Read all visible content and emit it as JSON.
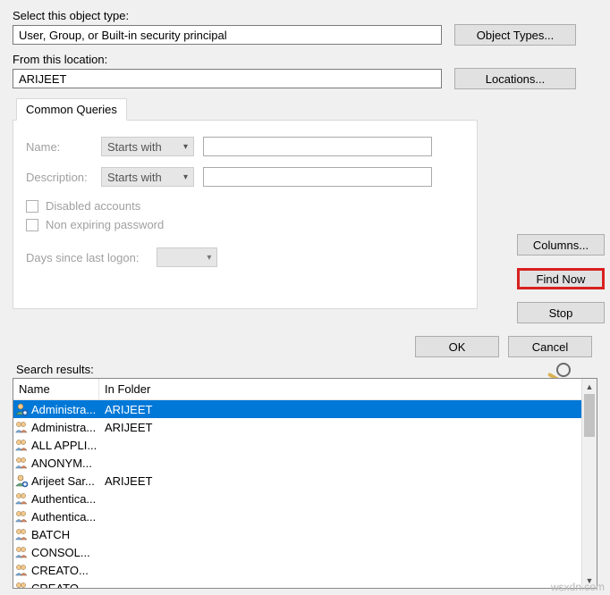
{
  "labels": {
    "selectType": "Select this object type:",
    "fromLocation": "From this location:",
    "commonQueries": "Common Queries",
    "name": "Name:",
    "description": "Description:",
    "disabled": "Disabled accounts",
    "nonExpiring": "Non expiring password",
    "daysLogon": "Days since last logon:",
    "searchResults": "Search results:",
    "colName": "Name",
    "colFolder": "In Folder"
  },
  "fields": {
    "objectType": "User, Group, or Built-in security principal",
    "location": "ARIJEET",
    "nameMode": "Starts with",
    "descMode": "Starts with",
    "nameVal": "",
    "descVal": ""
  },
  "buttons": {
    "objectTypes": "Object Types...",
    "locations": "Locations...",
    "columns": "Columns...",
    "findNow": "Find Now",
    "stop": "Stop",
    "ok": "OK",
    "cancel": "Cancel"
  },
  "results": [
    {
      "name": "Administra...",
      "folder": "ARIJEET",
      "type": "user",
      "selected": true
    },
    {
      "name": "Administra...",
      "folder": "ARIJEET",
      "type": "group"
    },
    {
      "name": "ALL APPLI...",
      "folder": "",
      "type": "group"
    },
    {
      "name": "ANONYM...",
      "folder": "",
      "type": "group"
    },
    {
      "name": "Arijeet Sar...",
      "folder": "ARIJEET",
      "type": "user"
    },
    {
      "name": "Authentica...",
      "folder": "",
      "type": "group"
    },
    {
      "name": "Authentica...",
      "folder": "",
      "type": "group"
    },
    {
      "name": "BATCH",
      "folder": "",
      "type": "group"
    },
    {
      "name": "CONSOL...",
      "folder": "",
      "type": "group"
    },
    {
      "name": "CREATO...",
      "folder": "",
      "type": "group"
    },
    {
      "name": "CREATO...",
      "folder": "",
      "type": "group"
    }
  ],
  "watermark": "wsxdn.com"
}
